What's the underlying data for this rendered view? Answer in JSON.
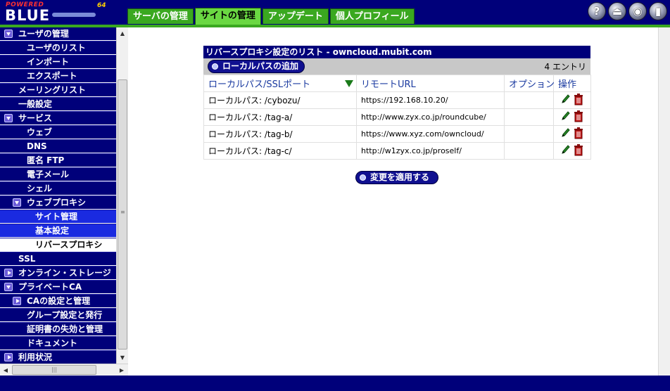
{
  "app": {
    "logo_powered": "POWERED",
    "logo_blue": "BLUE",
    "logo_version": "64"
  },
  "tabs": [
    {
      "label": "サーバの管理",
      "active": false
    },
    {
      "label": "サイトの管理",
      "active": true
    },
    {
      "label": "アップデート",
      "active": false
    },
    {
      "label": "個人プロフィール",
      "active": false
    }
  ],
  "header_icons": [
    {
      "name": "help-icon",
      "glyph": "?"
    },
    {
      "name": "logout-icon",
      "glyph": "⏏"
    },
    {
      "name": "view-icon",
      "glyph": "◉"
    },
    {
      "name": "exit-door-icon",
      "glyph": "▮"
    }
  ],
  "sidebar": {
    "items": [
      {
        "label": "ユーザの管理",
        "level": 0,
        "toggle": "down"
      },
      {
        "label": "ユーザのリスト",
        "level": 1
      },
      {
        "label": "インポート",
        "level": 1
      },
      {
        "label": "エクスポート",
        "level": 1
      },
      {
        "label": "メーリングリスト",
        "level": 0
      },
      {
        "label": "一般設定",
        "level": 0
      },
      {
        "label": "サービス",
        "level": 0,
        "toggle": "down"
      },
      {
        "label": "ウェブ",
        "level": 1
      },
      {
        "label": "DNS",
        "level": 1
      },
      {
        "label": "匿名 FTP",
        "level": 1
      },
      {
        "label": "電子メール",
        "level": 1
      },
      {
        "label": "シェル",
        "level": 1
      },
      {
        "label": "ウェブプロキシ",
        "level": 1,
        "toggle": "down"
      },
      {
        "label": "サイト管理",
        "level": 2
      },
      {
        "label": "基本設定",
        "level": 2
      },
      {
        "label": "リバースプロキシ",
        "level": 2,
        "selected": true
      },
      {
        "label": "SSL",
        "level": 0
      },
      {
        "label": "オンライン・ストレージ",
        "level": 0,
        "toggle": "right"
      },
      {
        "label": "プライベートCA",
        "level": 0,
        "toggle": "down"
      },
      {
        "label": "CAの設定と管理",
        "level": 1,
        "toggle": "right"
      },
      {
        "label": "グループ設定と発行",
        "level": 1
      },
      {
        "label": "証明書の失効と管理",
        "level": 1
      },
      {
        "label": "ドキュメント",
        "level": 1
      },
      {
        "label": "利用状況",
        "level": 0,
        "toggle": "right"
      }
    ]
  },
  "panel": {
    "title": "リバースプロキシ設定のリスト - owncloud.mubit.com",
    "add_button": "ローカルパスの追加",
    "entry_count": "4 エントリ",
    "columns": {
      "local_path": "ローカルパス/SSLポート",
      "remote_url": "リモートURL",
      "options": "オプション",
      "actions": "操作"
    },
    "rows": [
      {
        "local_path": "ローカルパス: /cybozu/",
        "remote_url": "https://192.168.10.20/",
        "options": ""
      },
      {
        "local_path": "ローカルパス: /tag-a/",
        "remote_url": "http://www.zyx.co.jp/roundcube/",
        "options": ""
      },
      {
        "local_path": "ローカルパス: /tag-b/",
        "remote_url": "https://www.xyz.com/owncloud/",
        "options": ""
      },
      {
        "local_path": "ローカルパス: /tag-c/",
        "remote_url": "http://w1zyx.co.jp/proself/",
        "options": ""
      }
    ],
    "apply_button": "変更を適用する"
  },
  "colors": {
    "navy": "#00007a",
    "tab_green": "#3aa820",
    "tab_active": "#6ad842",
    "sidebar_sub": "#1a2ae0",
    "header_text": "#1a3aa0"
  }
}
